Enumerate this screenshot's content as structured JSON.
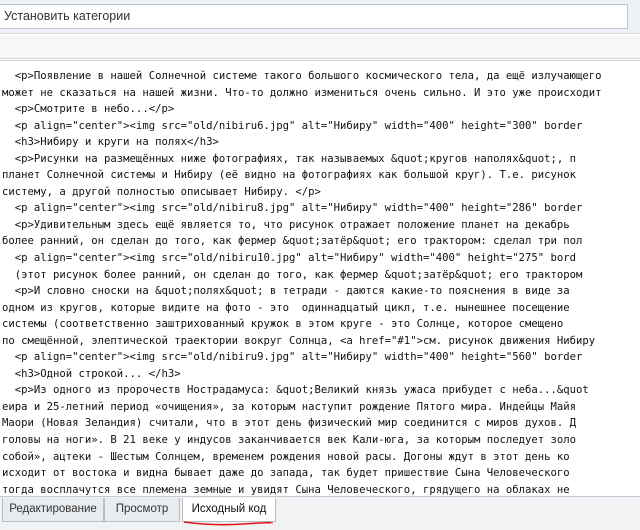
{
  "header": {
    "category_field_value": "Установить категории"
  },
  "editor": {
    "lines": [
      "  <p>Появление в нашей Солнечной системе такого большого космического тела, да ещё излучающего",
      "может не сказаться на нашей жизни. Что-то должно измениться очень сильно. И это уже происходит",
      "  <p>Смотрите в небо...</p>",
      "  <p align=\"center\"><img src=\"old/nibiru6.jpg\" alt=\"Нибиру\" width=\"400\" height=\"300\" border",
      "  <h3>Нибиру и круги на полях</h3>",
      "  <p>Рисунки на размещённых ниже фотографиях, так называемых &quot;кругов наполях&quot;, п",
      "планет Солнечной системы и Нибиру (её видно на фотографиях как большой круг). Т.е. рисунок",
      "систему, а другой полностью описывает Нибиру. </p>",
      "  <p align=\"center\"><img src=\"old/nibiru8.jpg\" alt=\"Нибиру\" width=\"400\" height=\"286\" border",
      "  <p>Удивительным здесь ещё является то, что рисунок отражает положение планет на декабрь",
      "более ранний, он сделан до того, как фермер &quot;затёр&quot; его трактором: сделал три пол",
      "  <p align=\"center\"><img src=\"old/nibiru10.jpg\" alt=\"Нибиру\" width=\"400\" height=\"275\" bord",
      "  (этот рисунок более ранний, он сделан до того, как фермер &quot;затёр&quot; его трактором",
      "  <p>И словно сноски на &quot;полях&quot; в тетради - даются какие-то пояснения в виде за",
      "одном из кругов, которые видите на фото - это  одиннадцатый цикл, т.е. нынешнее посещение",
      "системы (соответственно заштрихованный кружок в этом круге - это Солнце, которое смещено",
      "по смещённой, элептической траектории вокруг Солнца, <a href=\"#1\">см. рисунок движения Нибиру",
      "  <p align=\"center\"><img src=\"old/nibiru9.jpg\" alt=\"Нибиру\" width=\"400\" height=\"560\" border",
      "  <h3>Одной строкой... </h3>",
      "  <p>Из одного из пророчеств Нострадамуса: &quot;Великий князь ужаса прибудет с неба...&quot",
      "eира и 25-летний период «очищения», за которым наступит рождение Пятого мира. Индейцы Майя",
      "Маори (Новая Зеландия) считали, что в этот день физический мир соединится с миров духов. Д",
      "головы на ноги». В 21 веке у индусов заканчивается век Кали-юга, за которым последует золо",
      "собой», ацтеки - Шестым Солнцем, временем рождения новой расы. Догоны ждут в этот день ко",
      "исходит от востока и видна бывает даже до запада, так будет пришествие Сына Человеческого",
      "тогда восплачутся все племена земные и увидят Сына Человеческого, грядущего на облаках не",
      "так будет и в пришествие Сына Человеческого: и не думали, пока не пришел потоп и не истреб",
      "Человеческого...&quot;. Библия: &quot;И увидел я новое небо и новую землю, ибо прежнее не"
    ]
  },
  "tabs": {
    "edit": "Редактирование",
    "preview": "Просмотр",
    "source": "Исходный код",
    "active": "source"
  },
  "colors": {
    "annotation_underline": "#e8141c",
    "editor_background": "#ffffff",
    "chrome_background": "#eef1f5"
  }
}
